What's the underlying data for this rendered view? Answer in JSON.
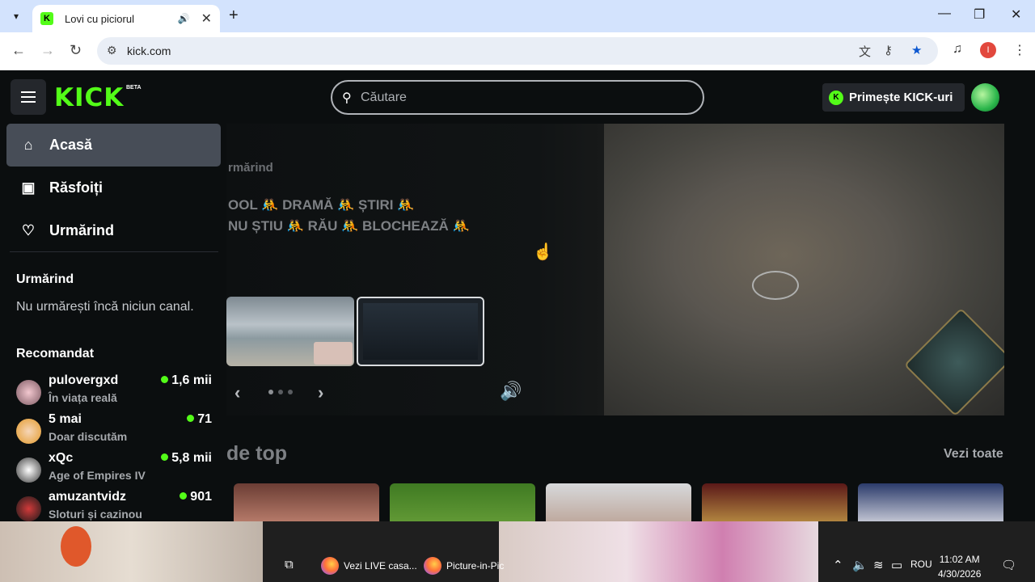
{
  "browser": {
    "tab_title": "Lovi cu piciorul",
    "tab_favicon": "K",
    "address": "kick.com",
    "new_tab_symbol": "+",
    "avatar_letter": "I"
  },
  "header": {
    "logo": "KICK",
    "logo_badge": "BETA",
    "search_placeholder": "Căutare",
    "get_kick_label": "Primește KICK-uri"
  },
  "sidebar": {
    "nav": [
      {
        "label": "Acasă",
        "icon": "home-icon"
      },
      {
        "label": "Răsfoiți",
        "icon": "browse-icon"
      },
      {
        "label": "Urmărind",
        "icon": "heart-icon"
      }
    ],
    "following_title": "Urmărind",
    "following_empty": "Nu urmărești încă niciun canal.",
    "recommended_title": "Recomandat",
    "recommended": [
      {
        "name": "pulovergxd",
        "category": "În viața reală",
        "viewers": "1,6 mii"
      },
      {
        "name": "5 mai",
        "category": "Doar discutăm",
        "viewers": "71"
      },
      {
        "name": "xQc",
        "category": "Age of Empires IV",
        "viewers": "5,8 mii"
      },
      {
        "name": "amuzantvidz",
        "category": "Sloturi și cazinou",
        "viewers": "901"
      }
    ]
  },
  "hero": {
    "crumb": "rmărind",
    "tags_line1": "OOL 🤼 DRAMĂ 🤼 ȘTIRI 🤼",
    "tags_line2": "NU ȘTIU 🤼 RĂU 🤼 BLOCHEAZĂ 🤼"
  },
  "top_section": {
    "title": "de top",
    "see_all": "Vezi toate"
  },
  "taskbar": {
    "apps": [
      "Vezi LIVE casa...",
      "Picture-in-Pic"
    ],
    "language": "ROU",
    "time": "11:02 AM",
    "date": "4/30/2026"
  },
  "colors": {
    "accent": "#53fc18",
    "bg": "#0b0e0f",
    "chrome_tabbar": "#d3e3fd"
  }
}
